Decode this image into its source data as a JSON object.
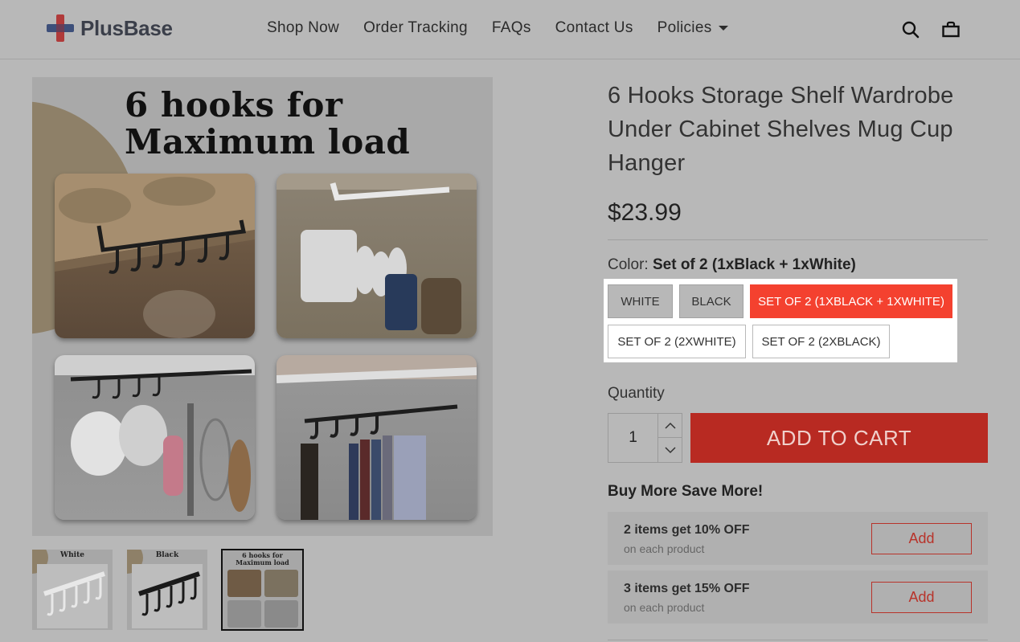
{
  "brand": {
    "name": "PlusBase"
  },
  "nav": {
    "items": [
      "Shop Now",
      "Order Tracking",
      "FAQs",
      "Contact Us",
      "Policies"
    ]
  },
  "header_icons": [
    "search-icon",
    "cart-bag-icon"
  ],
  "gallery": {
    "headline_line1": "6 hooks for",
    "headline_line2": "Maximum load",
    "thumbnails": [
      {
        "label": "White"
      },
      {
        "label": "Black"
      },
      {
        "label": "6 hooks for\nMaximum load"
      }
    ]
  },
  "product": {
    "title": "6 Hooks Storage Shelf Wardrobe Under Cabinet Shelves Mug Cup Hanger",
    "price": "$23.99",
    "color_label": "Color:",
    "color_value": "Set of 2 (1xBlack + 1xWhite)",
    "variants": [
      "WHITE",
      "BLACK",
      "SET OF 2 (1XBLACK + 1XWHITE)",
      "SET OF 2 (2XWHITE)",
      "SET OF 2 (2XBLACK)"
    ],
    "selected_variant": "SET OF 2 (1XBLACK + 1XWHITE)",
    "quantity_label": "Quantity",
    "quantity": "1",
    "add_to_cart": "ADD TO CART"
  },
  "bundles": {
    "title": "Buy More Save More!",
    "offers": [
      {
        "main": "2 items get 10% OFF",
        "sub": "on each product",
        "button": "Add"
      },
      {
        "main": "3 items get 15% OFF",
        "sub": "on each product",
        "button": "Add"
      }
    ]
  },
  "colors": {
    "accent": "#f4412f",
    "add_to_cart_bg": "#b82a22",
    "overlay_bg": "#b8b8b8"
  }
}
